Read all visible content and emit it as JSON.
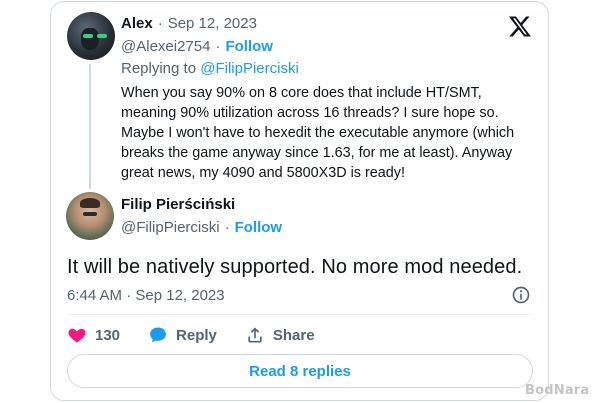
{
  "reply_tweet": {
    "author_name": "Alex",
    "separator": "·",
    "date": "Sep 12, 2023",
    "handle": "@Alexei2754",
    "follow_label": "Follow",
    "replying_prefix": "Replying to",
    "replying_to": "@FilipPierciski",
    "text": "When you say 90% on 8 core does that include HT/SMT, meaning 90% utilization across 16 threads? I sure hope so. Maybe I won't have to hexedit the executable anymore (which breaks the game anyway since 1.63, for me at least). Anyway great news, my 4090 and 5800X3D is ready!"
  },
  "main_tweet": {
    "author_name": "Filip Pierściński",
    "handle": "@FilipPierciski",
    "separator": "·",
    "follow_label": "Follow",
    "text": "It will be natively supported. No more mod needed.",
    "timestamp": "6:44 AM · Sep 12, 2023"
  },
  "actions": {
    "like_count": "130",
    "reply_label": "Reply",
    "share_label": "Share"
  },
  "read_replies_label": "Read 8 replies",
  "watermark": "BodNara",
  "colors": {
    "accent": "#1d9bf0",
    "like": "#f91880",
    "text": "#0f1419",
    "secondary": "#536471",
    "border": "#cfd9de"
  },
  "icons": {
    "brand": "x-logo-icon",
    "info": "info-icon",
    "like": "heart-icon",
    "reply": "speech-bubble-icon",
    "share": "share-upload-icon"
  }
}
